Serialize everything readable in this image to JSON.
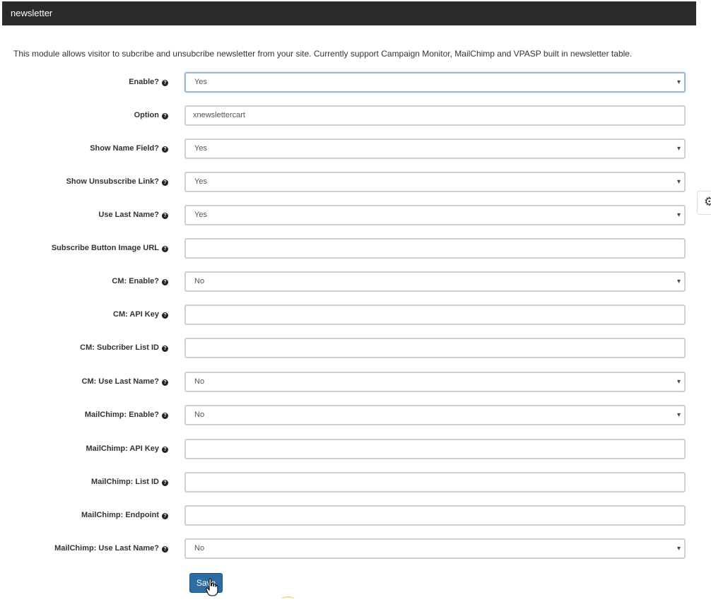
{
  "header": {
    "title": "newsletter"
  },
  "intro": "This module allows visitor to subcribe and unsubcribe newsletter from your site. Currently support Campaign Monitor, MailChimp and VPASP built in newsletter table.",
  "fields": {
    "enable": {
      "label": "Enable?",
      "value": "Yes"
    },
    "option": {
      "label": "Option",
      "value": "xnewslettercart"
    },
    "show_name": {
      "label": "Show Name Field?",
      "value": "Yes"
    },
    "show_unsub": {
      "label": "Show Unsubscribe Link?",
      "value": "Yes"
    },
    "use_last_name": {
      "label": "Use Last Name?",
      "value": "Yes"
    },
    "sub_btn_url": {
      "label": "Subscribe Button Image URL",
      "value": ""
    },
    "cm_enable": {
      "label": "CM: Enable?",
      "value": "No"
    },
    "cm_api_key": {
      "label": "CM: API Key",
      "value": ""
    },
    "cm_list_id": {
      "label": "CM: Subcriber List ID",
      "value": ""
    },
    "cm_last_name": {
      "label": "CM: Use Last Name?",
      "value": "No"
    },
    "mc_enable": {
      "label": "MailChimp: Enable?",
      "value": "No"
    },
    "mc_api_key": {
      "label": "MailChimp: API Key",
      "value": ""
    },
    "mc_list_id": {
      "label": "MailChimp: List ID",
      "value": ""
    },
    "mc_endpoint": {
      "label": "MailChimp: Endpoint",
      "value": ""
    },
    "mc_last_name": {
      "label": "MailChimp: Use Last Name?",
      "value": "No"
    }
  },
  "help_glyph": "?",
  "caret_glyph": "▾",
  "save_label": "Save",
  "icons": {
    "help": "question-circle-icon",
    "gear": "gear-icon",
    "cursor": "hand-pointer-icon"
  },
  "colors": {
    "header_bg": "#2b2b2b",
    "button_bg": "#2e6da4"
  }
}
